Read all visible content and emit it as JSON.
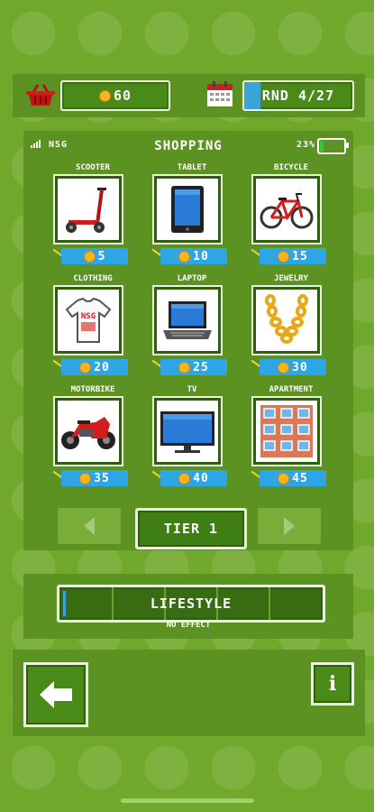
{
  "topbar": {
    "coins": "60",
    "round": "RND 4/27",
    "round_progress": 0.148
  },
  "panel": {
    "carrier": "NSG",
    "title": "SHOPPING",
    "battery_pct": "23%",
    "battery_level": 0.23
  },
  "items": [
    {
      "label": "SCOOTER",
      "price": "5",
      "icon": "scooter-icon"
    },
    {
      "label": "TABLET",
      "price": "10",
      "icon": "tablet-icon"
    },
    {
      "label": "BICYCLE",
      "price": "15",
      "icon": "bicycle-icon"
    },
    {
      "label": "CLOTHING",
      "price": "20",
      "icon": "tshirt-icon",
      "tshirt_text": "NSG"
    },
    {
      "label": "LAPTOP",
      "price": "25",
      "icon": "laptop-icon"
    },
    {
      "label": "JEWELRY",
      "price": "30",
      "icon": "gold-chain-icon"
    },
    {
      "label": "MOTORBIKE",
      "price": "35",
      "icon": "motorbike-icon"
    },
    {
      "label": "TV",
      "price": "40",
      "icon": "tv-icon"
    },
    {
      "label": "APARTMENT",
      "price": "45",
      "icon": "apartment-icon"
    }
  ],
  "tier": {
    "label": "TIER 1"
  },
  "lifestyle": {
    "label": "LIFESTYLE",
    "effect": "NO EFFECT",
    "level": 0.0
  },
  "colors": {
    "background": "#6fa82a",
    "panel": "#5c9222",
    "accent_blue": "#2ea6e6",
    "coin": "#f2b623"
  }
}
